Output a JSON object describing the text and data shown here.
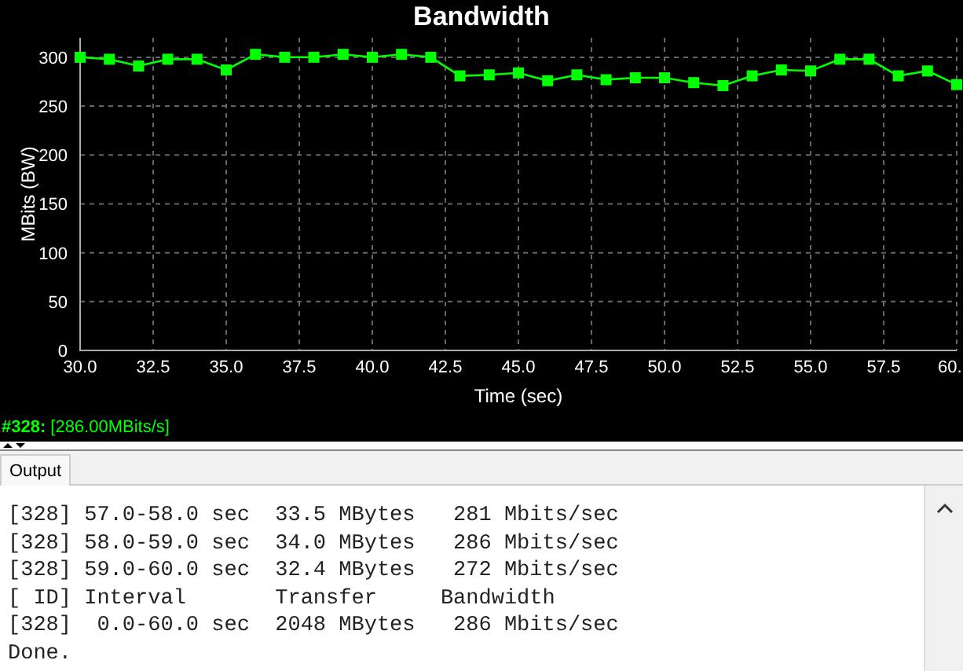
{
  "chart": {
    "chart_data": {
      "type": "line",
      "title": "Bandwidth",
      "xlabel": "Time (sec)",
      "ylabel": "MBits (BW)",
      "x": [
        30,
        31,
        32,
        33,
        34,
        35,
        36,
        37,
        38,
        39,
        40,
        41,
        42,
        43,
        44,
        45,
        46,
        47,
        48,
        49,
        50,
        51,
        52,
        53,
        54,
        55,
        56,
        57,
        58,
        59,
        60
      ],
      "grid": true,
      "series": [
        {
          "color": "#00ff00",
          "marker": "square",
          "values": [
            300,
            298,
            291,
            298,
            298,
            287,
            303,
            300,
            300,
            303,
            300,
            303,
            300,
            281,
            282,
            284,
            276,
            282,
            277,
            279,
            279,
            274,
            271,
            281,
            287,
            286,
            298,
            298,
            281,
            286,
            272
          ]
        }
      ],
      "xlim": [
        30,
        60
      ],
      "ylim": [
        0,
        320
      ],
      "xticks": [
        {
          "value": 30,
          "label": "30.0"
        },
        {
          "value": 32.5,
          "label": "32.5"
        },
        {
          "value": 35,
          "label": "35.0"
        },
        {
          "value": 37.5,
          "label": "37.5"
        },
        {
          "value": 40,
          "label": "40.0"
        },
        {
          "value": 42.5,
          "label": "42.5"
        },
        {
          "value": 45,
          "label": "45.0"
        },
        {
          "value": 47.5,
          "label": "47.5"
        },
        {
          "value": 50,
          "label": "50.0"
        },
        {
          "value": 52.5,
          "label": "52.5"
        },
        {
          "value": 55,
          "label": "55.0"
        },
        {
          "value": 57.5,
          "label": "57.5"
        },
        {
          "value": 60,
          "label": "60."
        }
      ],
      "yticks": [
        0,
        50,
        100,
        150,
        200,
        250,
        300
      ]
    }
  },
  "status": {
    "stream": "#328:",
    "reading": "[286.00MBits/s]"
  },
  "tabs": [
    {
      "label": "Output",
      "selected": true
    }
  ],
  "output": {
    "lines": [
      "[328] 57.0-58.0 sec  33.5 MBytes   281 Mbits/sec",
      "[328] 58.0-59.0 sec  34.0 MBytes   286 Mbits/sec",
      "[328] 59.0-60.0 sec  32.4 MBytes   272 Mbits/sec",
      "[ ID] Interval       Transfer     Bandwidth",
      "[328]  0.0-60.0 sec  2048 MBytes   286 Mbits/sec",
      "Done."
    ]
  }
}
